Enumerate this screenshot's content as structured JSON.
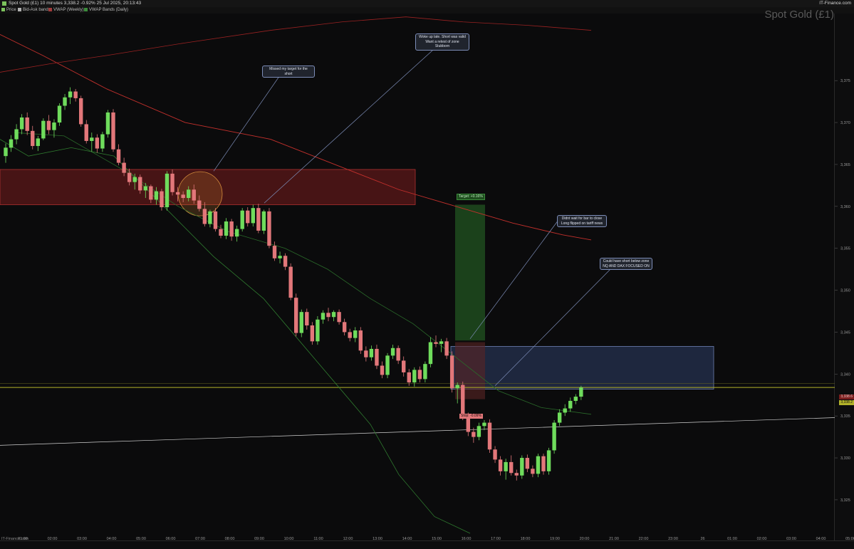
{
  "window": {
    "title": "Spot Gold (£1) 10 minutes 3,338.2 -0.92% 25 Jul 2025, 20:13:43",
    "brand": "IT-Finance.com"
  },
  "legend": [
    {
      "label": "Price",
      "color": "#7cc25c"
    },
    {
      "label": "Bid-Ask band",
      "color": "#b0b0b0"
    },
    {
      "label": "VWAP (Weekly)",
      "color": "#a23b3b"
    },
    {
      "label": "VWAP Bands (Daily)",
      "color": "#3c8c3c"
    }
  ],
  "chart_title": "Spot Gold (£1)",
  "footer_source": "IT-Finance.com",
  "colors": {
    "up": "#6fdc5c",
    "down": "#e2777a",
    "vwap_weekly": "#c2302c",
    "vwap_daily": "#2f7a2f",
    "zone_red": "#7a1d1d",
    "zone_blue": "#26324f",
    "target_green": "#1f4f1f",
    "level_line": "#b3b32a"
  },
  "annotations": [
    {
      "id": "note1",
      "lines": [
        "Missed my target for the short"
      ]
    },
    {
      "id": "note2",
      "lines": [
        "Woke up late. Short was valid",
        "Want a retest of zone",
        "Stubborn"
      ]
    },
    {
      "id": "note3",
      "lines": [
        "Didnt wait for bar to close",
        "Long flipped on tariff news"
      ]
    },
    {
      "id": "note4",
      "lines": [
        "Could have short below zone",
        "NQ AND DAX FOCUSED ON"
      ]
    }
  ],
  "trade": {
    "target_label": "Target: +0.16%",
    "stop_label": "Stop: -0.09%"
  },
  "price_tags": [
    "3,338.6",
    "3,338.2"
  ],
  "chart_data": {
    "type": "candlestick",
    "title": "Spot Gold (£1)",
    "interval": "10 minutes",
    "ylim": [
      3321,
      3383
    ],
    "y_ticks": [
      "3,375",
      "3,370",
      "3,365",
      "3,360",
      "3,355",
      "3,350",
      "3,345",
      "3,340",
      "3,335",
      "3,330",
      "3,325"
    ],
    "y_tick_values": [
      3375,
      3370,
      3365,
      3360,
      3355,
      3350,
      3345,
      3340,
      3335,
      3330,
      3325
    ],
    "x_ticks": [
      "01:00",
      "02:00",
      "03:00",
      "04:00",
      "05:00",
      "06:00",
      "07:00",
      "08:00",
      "09:00",
      "10:00",
      "11:00",
      "12:00",
      "13:00",
      "14:00",
      "15:00",
      "16:00",
      "17:00",
      "18:00",
      "19:00",
      "20:00",
      "21:00",
      "22:00",
      "23:00",
      "26",
      "01:00",
      "02:00",
      "03:00",
      "04:00",
      "05:00"
    ],
    "ohlc": [
      [
        3366.0,
        3367.5,
        3365.2,
        3367.0
      ],
      [
        3367.0,
        3368.5,
        3366.5,
        3368.0
      ],
      [
        3368.0,
        3369.8,
        3367.4,
        3369.2
      ],
      [
        3369.2,
        3371.0,
        3368.6,
        3370.6
      ],
      [
        3370.6,
        3371.2,
        3368.5,
        3369.0
      ],
      [
        3369.0,
        3369.6,
        3366.8,
        3367.2
      ],
      [
        3367.2,
        3368.4,
        3366.6,
        3368.1
      ],
      [
        3368.1,
        3370.5,
        3367.9,
        3370.2
      ],
      [
        3370.2,
        3370.9,
        3368.6,
        3369.1
      ],
      [
        3369.1,
        3370.4,
        3368.2,
        3370.0
      ],
      [
        3370.0,
        3372.3,
        3369.6,
        3372.0
      ],
      [
        3372.0,
        3373.4,
        3371.5,
        3373.0
      ],
      [
        3373.0,
        3374.2,
        3372.2,
        3373.7
      ],
      [
        3373.7,
        3374.0,
        3372.5,
        3372.9
      ],
      [
        3372.9,
        3373.2,
        3369.5,
        3369.8
      ],
      [
        3369.8,
        3370.3,
        3367.5,
        3367.8
      ],
      [
        3367.8,
        3368.8,
        3366.5,
        3368.2
      ],
      [
        3368.2,
        3368.6,
        3366.4,
        3366.9
      ],
      [
        3366.9,
        3368.9,
        3366.5,
        3368.6
      ],
      [
        3368.6,
        3371.5,
        3368.2,
        3371.2
      ],
      [
        3371.2,
        3371.6,
        3366.5,
        3366.8
      ],
      [
        3366.8,
        3367.4,
        3364.9,
        3365.2
      ],
      [
        3365.2,
        3365.8,
        3363.6,
        3364.0
      ],
      [
        3364.0,
        3364.5,
        3362.5,
        3362.9
      ],
      [
        3362.9,
        3363.9,
        3362.0,
        3363.5
      ],
      [
        3363.5,
        3363.8,
        3361.5,
        3361.9
      ],
      [
        3361.9,
        3362.8,
        3361.0,
        3362.4
      ],
      [
        3362.4,
        3362.6,
        3360.4,
        3360.8
      ],
      [
        3360.8,
        3362.3,
        3360.2,
        3361.8
      ],
      [
        3361.8,
        3362.1,
        3359.5,
        3359.9
      ],
      [
        3359.9,
        3364.2,
        3359.5,
        3363.9
      ],
      [
        3363.9,
        3364.4,
        3361.3,
        3361.7
      ],
      [
        3361.7,
        3362.3,
        3360.6,
        3361.4
      ],
      [
        3361.4,
        3361.8,
        3360.5,
        3361.0
      ],
      [
        3361.0,
        3362.4,
        3360.6,
        3362.0
      ],
      [
        3362.0,
        3362.6,
        3360.3,
        3360.7
      ],
      [
        3360.7,
        3361.3,
        3359.4,
        3359.7
      ],
      [
        3359.7,
        3360.5,
        3357.6,
        3357.9
      ],
      [
        3357.9,
        3359.6,
        3357.5,
        3359.4
      ],
      [
        3359.4,
        3359.8,
        3357.0,
        3357.3
      ],
      [
        3357.3,
        3357.8,
        3356.2,
        3356.5
      ],
      [
        3356.5,
        3358.6,
        3356.1,
        3358.2
      ],
      [
        3358.2,
        3358.5,
        3355.9,
        3356.4
      ],
      [
        3356.4,
        3357.7,
        3355.8,
        3357.3
      ],
      [
        3357.3,
        3359.8,
        3357.0,
        3359.5
      ],
      [
        3359.5,
        3359.9,
        3357.6,
        3358.0
      ],
      [
        3358.0,
        3360.2,
        3357.6,
        3359.8
      ],
      [
        3359.8,
        3360.3,
        3356.8,
        3357.1
      ],
      [
        3357.1,
        3359.6,
        3356.7,
        3359.4
      ],
      [
        3359.4,
        3359.8,
        3355.0,
        3355.3
      ],
      [
        3355.3,
        3355.8,
        3353.5,
        3353.8
      ],
      [
        3353.8,
        3354.6,
        3353.2,
        3354.1
      ],
      [
        3354.1,
        3354.4,
        3352.4,
        3352.8
      ],
      [
        3352.8,
        3353.2,
        3348.8,
        3349.1
      ],
      [
        3349.1,
        3349.6,
        3344.5,
        3344.9
      ],
      [
        3344.9,
        3347.7,
        3344.4,
        3347.4
      ],
      [
        3347.4,
        3347.8,
        3345.3,
        3345.8
      ],
      [
        3345.8,
        3346.2,
        3343.5,
        3343.9
      ],
      [
        3343.9,
        3346.9,
        3343.5,
        3346.5
      ],
      [
        3346.5,
        3347.6,
        3346.0,
        3347.3
      ],
      [
        3347.3,
        3347.9,
        3346.3,
        3346.8
      ],
      [
        3346.8,
        3347.6,
        3346.3,
        3347.4
      ],
      [
        3347.4,
        3347.7,
        3345.9,
        3346.2
      ],
      [
        3346.2,
        3346.6,
        3344.6,
        3345.0
      ],
      [
        3345.0,
        3345.4,
        3343.9,
        3344.3
      ],
      [
        3344.3,
        3345.6,
        3343.8,
        3345.2
      ],
      [
        3345.2,
        3345.6,
        3342.4,
        3342.8
      ],
      [
        3342.8,
        3343.3,
        3341.5,
        3342.0
      ],
      [
        3342.0,
        3343.4,
        3341.6,
        3343.0
      ],
      [
        3343.0,
        3343.5,
        3340.6,
        3341.0
      ],
      [
        3341.0,
        3341.5,
        3339.5,
        3339.9
      ],
      [
        3339.9,
        3342.5,
        3339.5,
        3342.2
      ],
      [
        3342.2,
        3343.5,
        3341.8,
        3343.1
      ],
      [
        3343.1,
        3343.4,
        3341.2,
        3341.6
      ],
      [
        3341.6,
        3342.1,
        3339.7,
        3340.2
      ],
      [
        3340.2,
        3340.6,
        3338.6,
        3339.0
      ],
      [
        3339.0,
        3340.8,
        3338.5,
        3340.5
      ],
      [
        3340.5,
        3340.9,
        3339.0,
        3339.4
      ],
      [
        3339.4,
        3341.5,
        3339.0,
        3341.2
      ],
      [
        3341.2,
        3344.4,
        3340.8,
        3343.8
      ],
      [
        3343.8,
        3344.6,
        3343.2,
        3343.6
      ],
      [
        3343.6,
        3344.2,
        3342.6,
        3343.9
      ],
      [
        3343.9,
        3344.3,
        3341.8,
        3342.2
      ],
      [
        3342.2,
        3342.7,
        3337.8,
        3338.3
      ],
      [
        3338.3,
        3339.0,
        3336.5,
        3338.7
      ],
      [
        3338.7,
        3339.1,
        3334.5,
        3335.0
      ],
      [
        3335.0,
        3335.4,
        3332.6,
        3333.1
      ],
      [
        3333.1,
        3333.6,
        3331.8,
        3332.5
      ],
      [
        3332.5,
        3334.2,
        3332.1,
        3333.8
      ],
      [
        3333.8,
        3334.5,
        3333.3,
        3334.2
      ],
      [
        3334.2,
        3334.6,
        3330.6,
        3331.0
      ],
      [
        3331.0,
        3331.4,
        3329.4,
        3329.8
      ],
      [
        3329.8,
        3330.2,
        3327.9,
        3328.4
      ],
      [
        3328.4,
        3329.9,
        3327.4,
        3329.5
      ],
      [
        3329.5,
        3330.3,
        3327.9,
        3328.2
      ],
      [
        3328.2,
        3328.6,
        3327.3,
        3327.9
      ],
      [
        3327.9,
        3330.3,
        3327.5,
        3330.0
      ],
      [
        3330.0,
        3330.4,
        3328.3,
        3328.7
      ],
      [
        3328.7,
        3329.1,
        3327.7,
        3328.1
      ],
      [
        3328.1,
        3330.5,
        3327.7,
        3330.2
      ],
      [
        3330.2,
        3330.5,
        3328.0,
        3328.4
      ],
      [
        3328.4,
        3331.2,
        3328.0,
        3330.9
      ],
      [
        3330.9,
        3334.5,
        3330.5,
        3334.2
      ],
      [
        3334.2,
        3335.8,
        3333.8,
        3335.4
      ],
      [
        3335.4,
        3336.4,
        3335.0,
        3335.9
      ],
      [
        3335.9,
        3337.2,
        3335.5,
        3336.8
      ],
      [
        3336.8,
        3337.6,
        3336.4,
        3337.3
      ],
      [
        3337.3,
        3338.6,
        3336.9,
        3338.4
      ]
    ]
  }
}
